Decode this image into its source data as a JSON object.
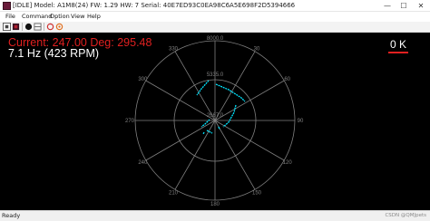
{
  "window": {
    "title": "[IDLE] Model: A1M8(24) FW: 1.29 HW: 7 Serial: 40E7ED93C0EA98C6A5E698F2D5394666",
    "icon": "app-icon",
    "controls": [
      "minimize-icon",
      "maximize-icon",
      "close-icon"
    ],
    "min_glyph": "—",
    "max_glyph": "☐",
    "close_glyph": "✕"
  },
  "menu": {
    "items": [
      {
        "label": "File"
      },
      {
        "label": "Command"
      },
      {
        "label": "Option"
      },
      {
        "label": "View"
      },
      {
        "label": "Help"
      }
    ]
  },
  "toolbar": {
    "buttons": [
      "connect-icon",
      "stop-icon",
      "record-icon",
      "scan-icon",
      "reset-icon",
      "settings-icon"
    ]
  },
  "display": {
    "current_line": "Current: 247.00 Deg: 295.48",
    "freq_line": "7.1 Hz (423 RPM)",
    "distance_unit": "0 K",
    "colors": {
      "background": "#000000",
      "grid": "#808080",
      "points": "#00e5ff",
      "current": "#e02020",
      "freq": "#ffffff"
    }
  },
  "polar": {
    "radius_labels": [
      "8000.0",
      "5335.0",
      "2667.0"
    ],
    "angle_labels": [
      "30",
      "60",
      "90",
      "120",
      "150",
      "180",
      "210",
      "240",
      "270",
      "300",
      "330"
    ]
  },
  "status": {
    "text": "Ready",
    "watermark": "CSDN @QMJpets"
  }
}
